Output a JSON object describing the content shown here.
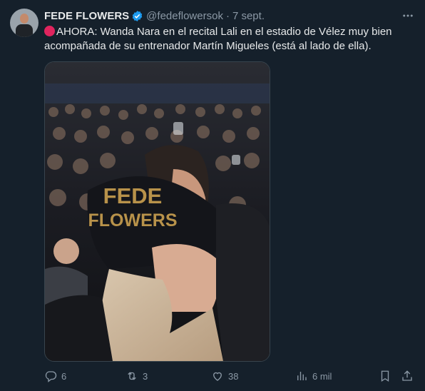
{
  "tweet": {
    "author_name": "FEDE FLOWERS",
    "handle": "@fedeflowersok",
    "separator": "·",
    "date": "7 sept.",
    "text_line1": "AHORA: Wanda Nara  en el recital Lali en el estadio de Vélez muy bien",
    "text_line2": "acompañada de su entrenador Martín Migueles (está al lado de ella).",
    "watermark_line1": "FEDE",
    "watermark_line2": "FLOWERS"
  },
  "actions": {
    "replies": "6",
    "retweets": "3",
    "likes": "38",
    "views": "6 mil"
  },
  "icons": {
    "verified": "verified-badge-icon",
    "more": "more-options-icon",
    "reply": "reply-icon",
    "retweet": "retweet-icon",
    "like": "like-icon",
    "views": "views-icon",
    "bookmark": "bookmark-icon",
    "share": "share-icon",
    "alert": "red-circle-icon"
  },
  "colors": {
    "background": "#15202b",
    "text": "#e7e9ea",
    "muted": "#8b98a5",
    "verified_blue": "#1d9bf0",
    "watermark_gold": "#b8924a"
  }
}
